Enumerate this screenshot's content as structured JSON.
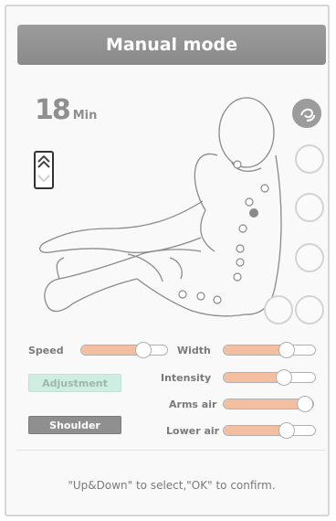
{
  "header": {
    "title": "Manual mode"
  },
  "timer": {
    "value": "18",
    "unit": "Min"
  },
  "controls": {
    "speed": {
      "label": "Speed",
      "level": 0.82
    },
    "width": {
      "label": "Width",
      "level": 0.78
    },
    "intensity": {
      "label": "Intensity",
      "level": 0.75
    },
    "arms_air": {
      "label": "Arms air",
      "level": 1.0
    },
    "lower_air": {
      "label": "Lower air",
      "level": 0.78
    }
  },
  "buttons": {
    "adjustment": "Adjustment",
    "shoulder": "Shoulder"
  },
  "footer": {
    "hint": "\"Up&Down\" to select,\"OK\" to confirm."
  },
  "colors": {
    "slider_fill": "#f3bfa0",
    "adjustment_bg": "#cdeee0",
    "header_bg": "#9c9c9c"
  }
}
